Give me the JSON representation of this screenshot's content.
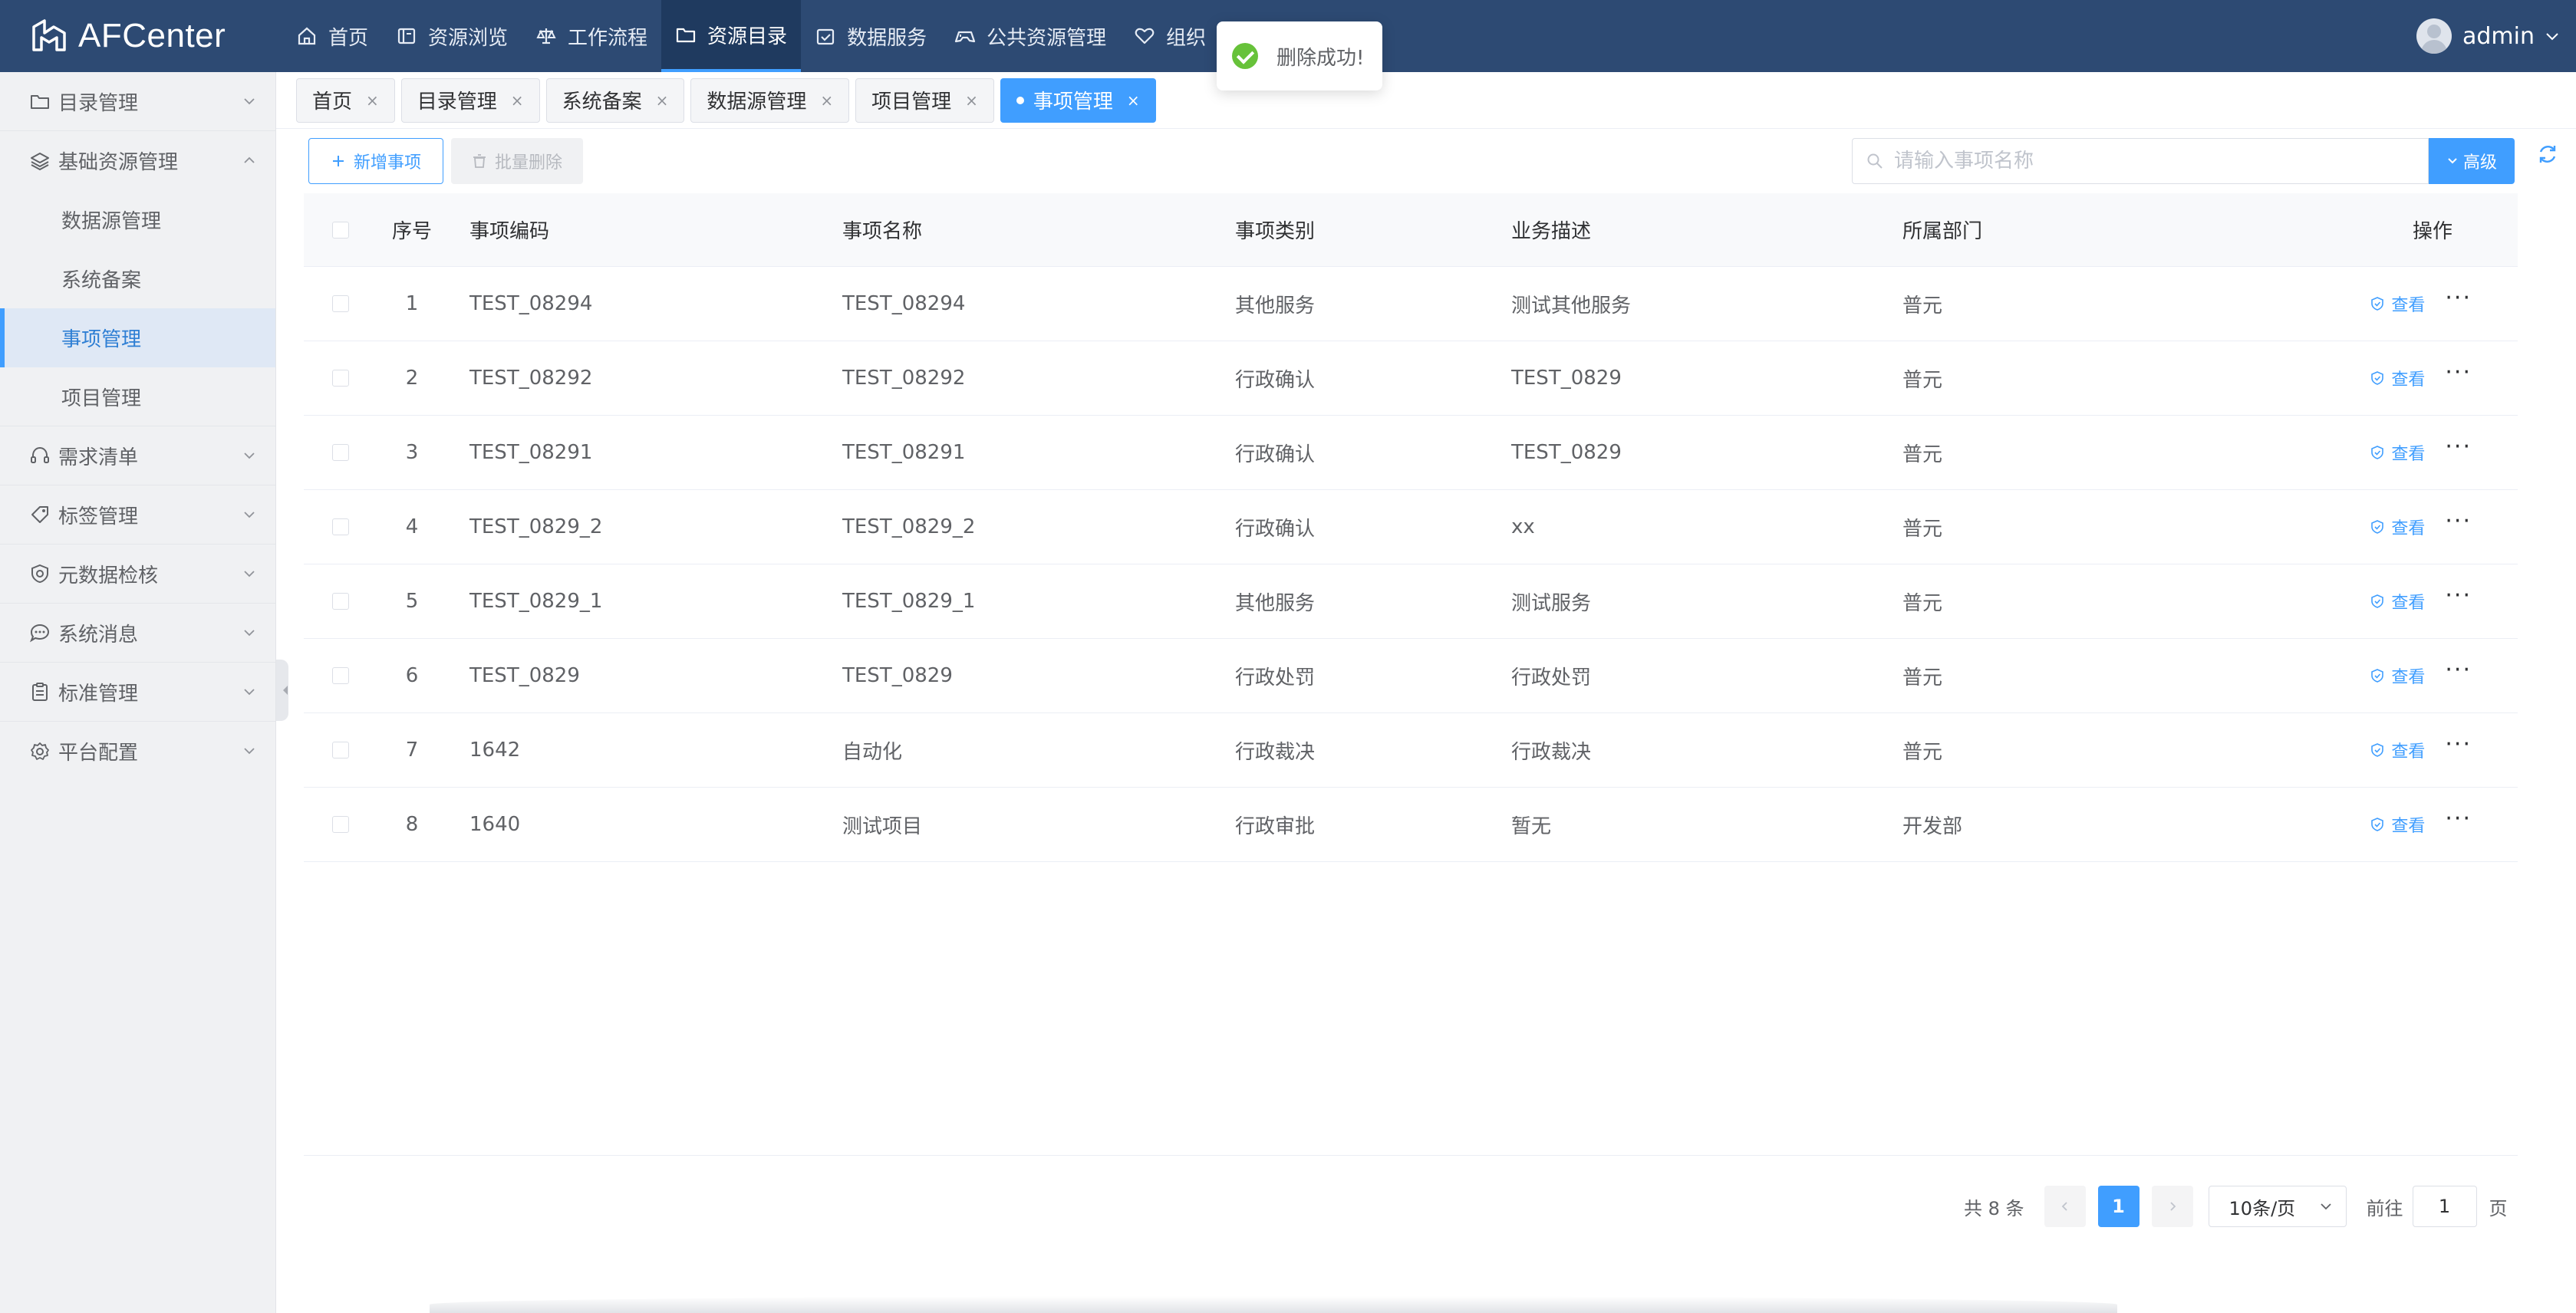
{
  "app": {
    "name": "AFCenter"
  },
  "topnav": [
    {
      "label": "首页",
      "icon": "home-icon"
    },
    {
      "label": "资源浏览",
      "icon": "book-icon"
    },
    {
      "label": "工作流程",
      "icon": "scale-icon"
    },
    {
      "label": "资源目录",
      "icon": "folder-icon",
      "active": true
    },
    {
      "label": "数据服务",
      "icon": "calendar-check-icon"
    },
    {
      "label": "公共资源管理",
      "icon": "gamepad-icon"
    },
    {
      "label": "组织",
      "icon": "heart-icon"
    }
  ],
  "user": {
    "name": "admin"
  },
  "toast": {
    "message": "删除成功!"
  },
  "sidebar": {
    "items": [
      {
        "label": "目录管理",
        "icon": "folder-icon"
      },
      {
        "label": "基础资源管理",
        "icon": "layers-icon",
        "expanded": true,
        "children": [
          "数据源管理",
          "系统备案",
          "事项管理",
          "项目管理"
        ],
        "active_child": "事项管理"
      },
      {
        "label": "需求清单",
        "icon": "headset-icon"
      },
      {
        "label": "标签管理",
        "icon": "tag-icon"
      },
      {
        "label": "元数据检核",
        "icon": "shield-check-icon"
      },
      {
        "label": "系统消息",
        "icon": "chat-icon"
      },
      {
        "label": "标准管理",
        "icon": "clipboard-icon"
      },
      {
        "label": "平台配置",
        "icon": "settings-icon"
      }
    ]
  },
  "tabs": [
    {
      "label": "首页"
    },
    {
      "label": "目录管理"
    },
    {
      "label": "系统备案"
    },
    {
      "label": "数据源管理"
    },
    {
      "label": "项目管理"
    },
    {
      "label": "事项管理",
      "active": true
    }
  ],
  "toolbar": {
    "add_label": "新增事项",
    "batch_delete_label": "批量删除",
    "search_placeholder": "请输入事项名称",
    "advanced_label": "高级"
  },
  "table": {
    "columns": [
      "序号",
      "事项编码",
      "事项名称",
      "事项类别",
      "业务描述",
      "所属部门",
      "操作"
    ],
    "view_label": "查看",
    "more_label": "···",
    "rows": [
      {
        "idx": "1",
        "code": "TEST_08294",
        "name": "TEST_08294",
        "type": "其他服务",
        "desc": "测试其他服务",
        "dept": "普元"
      },
      {
        "idx": "2",
        "code": "TEST_08292",
        "name": "TEST_08292",
        "type": "行政确认",
        "desc": "TEST_0829",
        "dept": "普元"
      },
      {
        "idx": "3",
        "code": "TEST_08291",
        "name": "TEST_08291",
        "type": "行政确认",
        "desc": "TEST_0829",
        "dept": "普元"
      },
      {
        "idx": "4",
        "code": "TEST_0829_2",
        "name": "TEST_0829_2",
        "type": "行政确认",
        "desc": "xx",
        "dept": "普元"
      },
      {
        "idx": "5",
        "code": "TEST_0829_1",
        "name": "TEST_0829_1",
        "type": "其他服务",
        "desc": "测试服务",
        "dept": "普元"
      },
      {
        "idx": "6",
        "code": "TEST_0829",
        "name": "TEST_0829",
        "type": "行政处罚",
        "desc": "行政处罚",
        "dept": "普元"
      },
      {
        "idx": "7",
        "code": "1642",
        "name": "自动化",
        "type": "行政裁决",
        "desc": "行政裁决",
        "dept": "普元"
      },
      {
        "idx": "8",
        "code": "1640",
        "name": "测试项目",
        "type": "行政审批",
        "desc": "暂无",
        "dept": "开发部"
      }
    ]
  },
  "pagination": {
    "total_label": "共 8 条",
    "current_page": "1",
    "page_size_label": "10条/页",
    "goto_label": "前往",
    "goto_value": "1",
    "page_suffix": "页"
  }
}
